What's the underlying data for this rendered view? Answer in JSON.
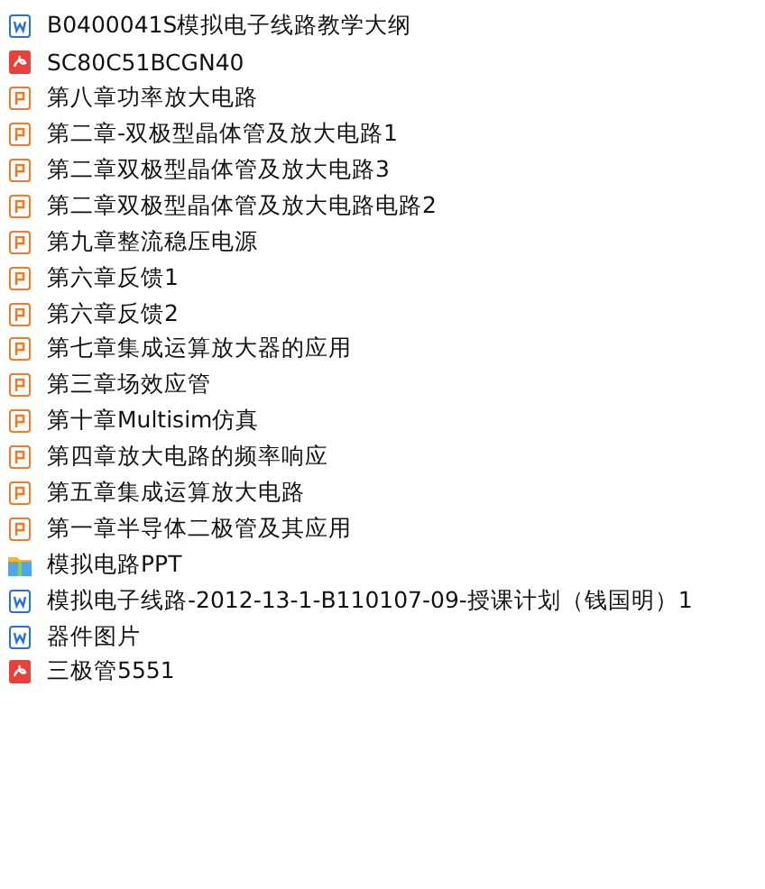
{
  "files": [
    {
      "kind": "word",
      "name": "B0400041S模拟电子线路教学大纲"
    },
    {
      "kind": "pdf",
      "name": "SC80C51BCGN40"
    },
    {
      "kind": "ppt",
      "name": "第八章功率放大电路"
    },
    {
      "kind": "ppt",
      "name": "第二章-双极型晶体管及放大电路1"
    },
    {
      "kind": "ppt",
      "name": "第二章双极型晶体管及放大电路3"
    },
    {
      "kind": "ppt",
      "name": "第二章双极型晶体管及放大电路电路2"
    },
    {
      "kind": "ppt",
      "name": "第九章整流稳压电源"
    },
    {
      "kind": "ppt",
      "name": "第六章反馈1"
    },
    {
      "kind": "ppt",
      "name": "第六章反馈2"
    },
    {
      "kind": "ppt",
      "name": "第七章集成运算放大器的应用"
    },
    {
      "kind": "ppt",
      "name": "第三章场效应管"
    },
    {
      "kind": "ppt",
      "name": "第十章Multisim仿真"
    },
    {
      "kind": "ppt",
      "name": "第四章放大电路的频率响应"
    },
    {
      "kind": "ppt",
      "name": "第五章集成运算放大电路"
    },
    {
      "kind": "ppt",
      "name": "第一章半导体二极管及其应用"
    },
    {
      "kind": "archive",
      "name": "模拟电路PPT"
    },
    {
      "kind": "word",
      "name": "模拟电子线路-2012-13-1-B110107-09-授课计划（钱国明）1"
    },
    {
      "kind": "word",
      "name": "器件图片"
    },
    {
      "kind": "pdf",
      "name": "三极管5551"
    }
  ]
}
